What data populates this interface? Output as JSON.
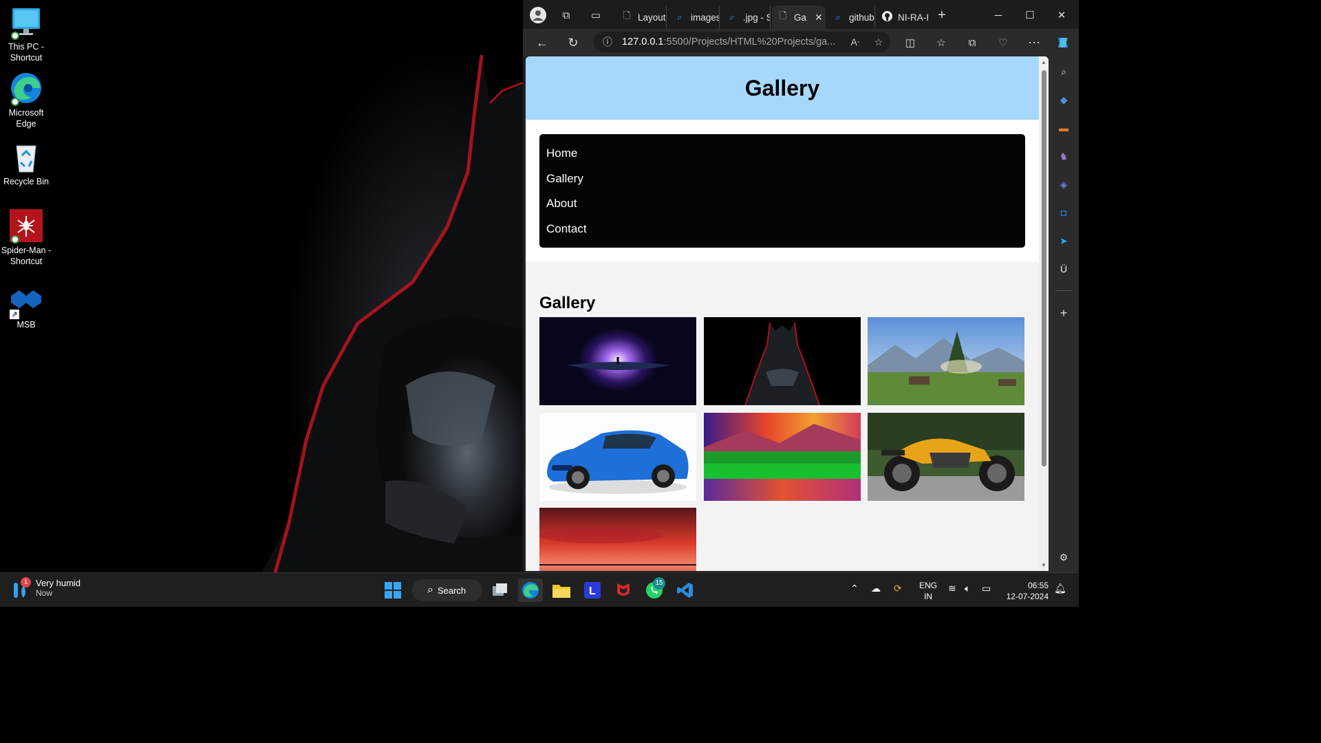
{
  "desktop": {
    "icons": [
      {
        "label": "This PC - Shortcut",
        "icon": "monitor-icon"
      },
      {
        "label": "Microsoft Edge",
        "icon": "edge-icon"
      },
      {
        "label": "Recycle Bin",
        "icon": "recycle-bin-icon"
      },
      {
        "label": "Spider-Man - Shortcut",
        "icon": "spiderman-icon"
      },
      {
        "label": "MSB",
        "icon": "msb-icon"
      }
    ]
  },
  "browser": {
    "tabs": [
      {
        "label": "Layout",
        "icon": "page-icon"
      },
      {
        "label": "images",
        "icon": "search-icon"
      },
      {
        "label": ".jpg - S",
        "icon": "search-icon"
      },
      {
        "label": "Ga",
        "icon": "page-icon",
        "active": true
      },
      {
        "label": "github",
        "icon": "search-icon"
      },
      {
        "label": "NI-RA-I",
        "icon": "github-icon"
      }
    ],
    "address": {
      "host": "127.0.0.1",
      "path": ":5500/Projects/HTML%20Projects/ga..."
    }
  },
  "site": {
    "header_title": "Gallery",
    "nav": [
      "Home",
      "Gallery",
      "About",
      "Contact"
    ],
    "section_title": "Gallery",
    "images": [
      {
        "subject": "space-portal-image"
      },
      {
        "subject": "batman-image"
      },
      {
        "subject": "mountain-landscape-image"
      },
      {
        "subject": "blue-sports-car-image"
      },
      {
        "subject": "colorful-lake-image"
      },
      {
        "subject": "yellow-motorcycle-image"
      },
      {
        "subject": "red-sunset-image"
      }
    ]
  },
  "taskbar": {
    "weather": {
      "title": "Very humid",
      "subtitle": "Now",
      "badge": "1"
    },
    "search_label": "Search",
    "whatsapp_badge": "15",
    "language": {
      "line1": "ENG",
      "line2": "IN"
    },
    "clock": {
      "time": "06:55",
      "date": "12-07-2024"
    }
  },
  "colors": {
    "site_header": "#a6d8fc",
    "site_nav": "#040404",
    "site_main": "#f3f3f3",
    "browser_chrome": "#2b2b2b"
  }
}
